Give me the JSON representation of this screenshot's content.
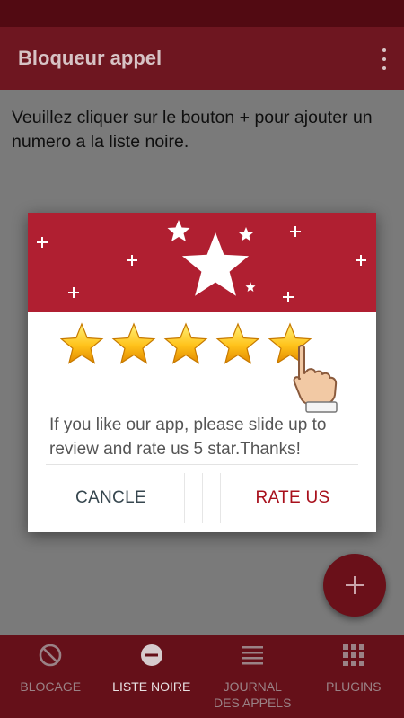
{
  "app_bar": {
    "title": "Bloqueur appel"
  },
  "content": {
    "instruction": "Veuillez cliquer sur le bouton + pour ajouter un numero a la liste noire."
  },
  "dialog": {
    "message": "If you like our app, please slide up to review and rate us 5 star.Thanks!",
    "cancel_label": "CANCLE",
    "rate_label": "RATE US",
    "rating_stars": 5,
    "header_icon": "big-star-icon"
  },
  "fab": {
    "icon": "plus-icon"
  },
  "bottom_nav": {
    "items": [
      {
        "label": "BLOCAGE",
        "icon": "block-icon",
        "active": false
      },
      {
        "label": "LISTE NOIRE",
        "icon": "minus-circle-icon",
        "active": true
      },
      {
        "label": "JOURNAL DES APPELS",
        "label_lines": [
          "JOURNAL",
          "DES APPELS"
        ],
        "icon": "list-icon",
        "active": false
      },
      {
        "label": "PLUGINS",
        "icon": "grid-icon",
        "active": false
      }
    ]
  },
  "colors": {
    "status_bar": "#520a12",
    "app_bar": "#6e1620",
    "dialog_header": "#b01f31",
    "accent": "#a8101c",
    "scrim_background": "#7a7a7a",
    "bottom_nav": "#651019"
  }
}
